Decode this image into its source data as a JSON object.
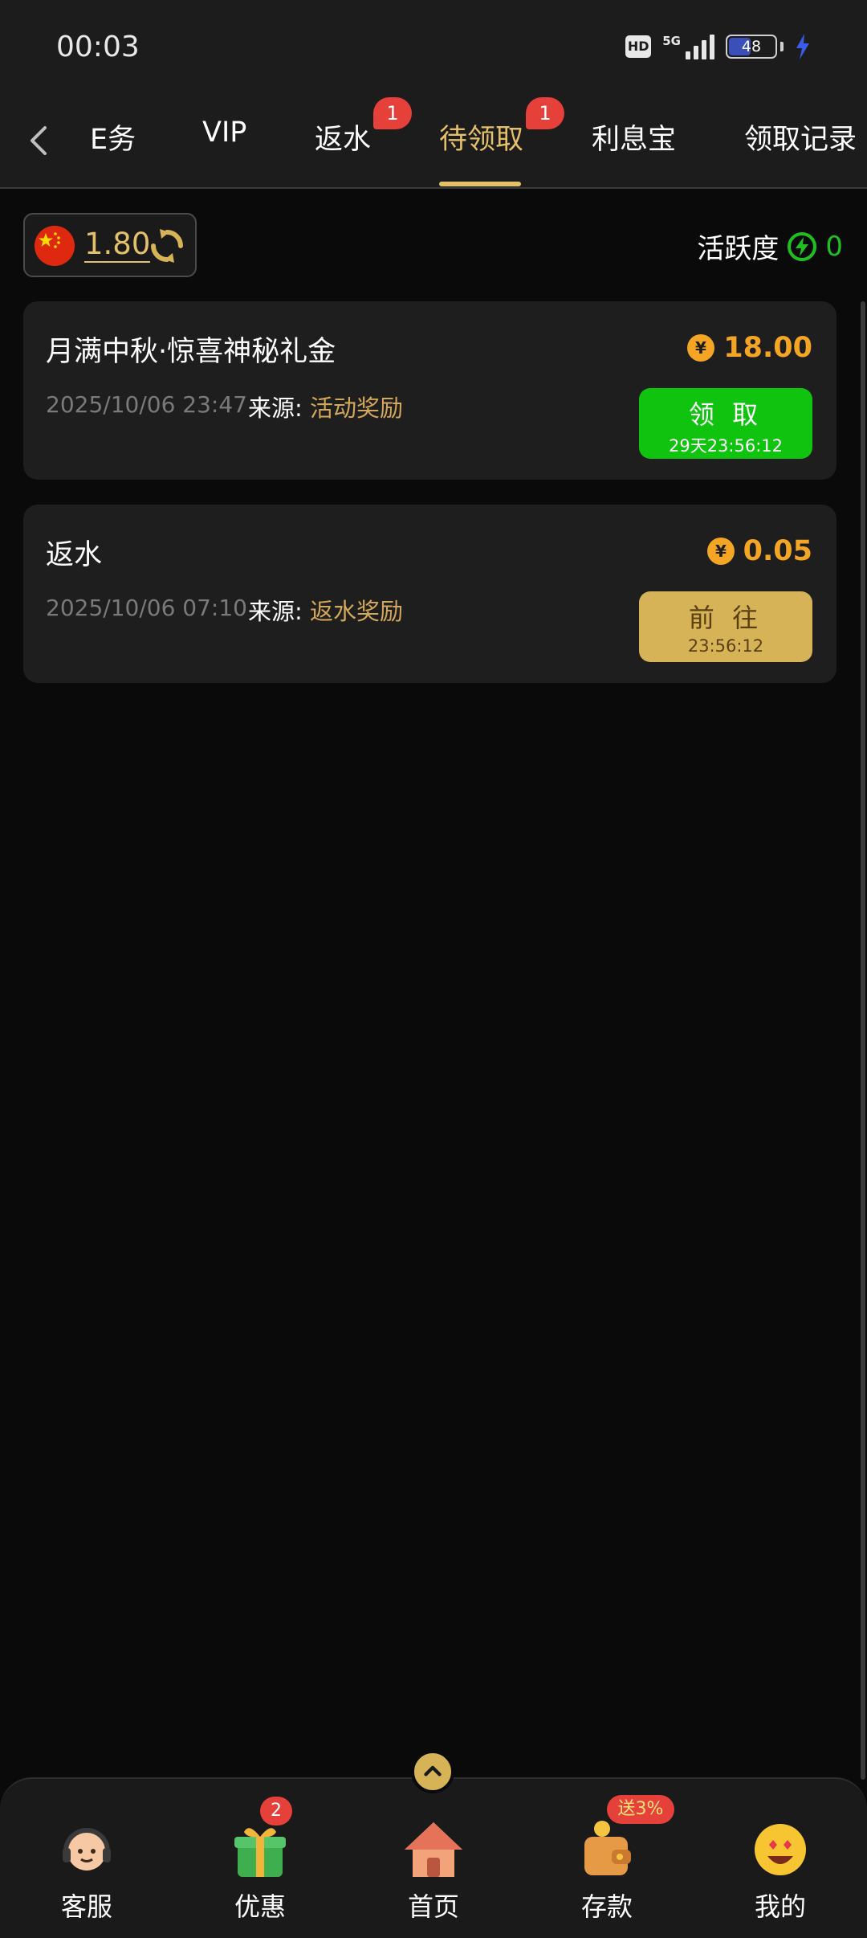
{
  "status_bar": {
    "time": "00:03",
    "network": "5G",
    "battery": "48"
  },
  "tabs": [
    {
      "label": "任务",
      "shown": "E务"
    },
    {
      "label": "VIP",
      "shown": "VIP"
    },
    {
      "label": "返水",
      "shown": "返水",
      "badge": "1"
    },
    {
      "label": "待领取",
      "shown": "待领取",
      "badge": "1",
      "active": true
    },
    {
      "label": "利息宝",
      "shown": "利息宝"
    },
    {
      "label": "领取记录",
      "shown": "领取记录"
    }
  ],
  "balance": {
    "value": "1.80"
  },
  "activity": {
    "label": "活跃度",
    "value": "0"
  },
  "cards": [
    {
      "title": "月满中秋·惊喜神秘礼金",
      "amount": "18.00",
      "date": "2025/10/06 23:47",
      "source_label": "来源:",
      "source_value": "活动奖励",
      "button_label": "领 取",
      "button_timer": "29天23:56:12"
    },
    {
      "title": "返水",
      "amount": "0.05",
      "date": "2025/10/06 07:10",
      "source_label": "来源:",
      "source_value": "返水奖励",
      "button_label": "前 往",
      "button_timer": "23:56:12"
    }
  ],
  "bottom_nav": [
    {
      "label": "客服",
      "icon": "headset-icon"
    },
    {
      "label": "优惠",
      "icon": "gift-icon",
      "badge": "2"
    },
    {
      "label": "首页",
      "icon": "home-icon"
    },
    {
      "label": "存款",
      "icon": "wallet-icon",
      "badge": "送3%"
    },
    {
      "label": "我的",
      "icon": "profile-emoji-icon"
    }
  ],
  "colors": {
    "accent_gold": "#e4c06a",
    "amount_orange": "#f5a524",
    "claim_green": "#0fc30f",
    "badge_red": "#e5403a",
    "background": "#0a0a0a",
    "card": "#1e1e1e"
  }
}
